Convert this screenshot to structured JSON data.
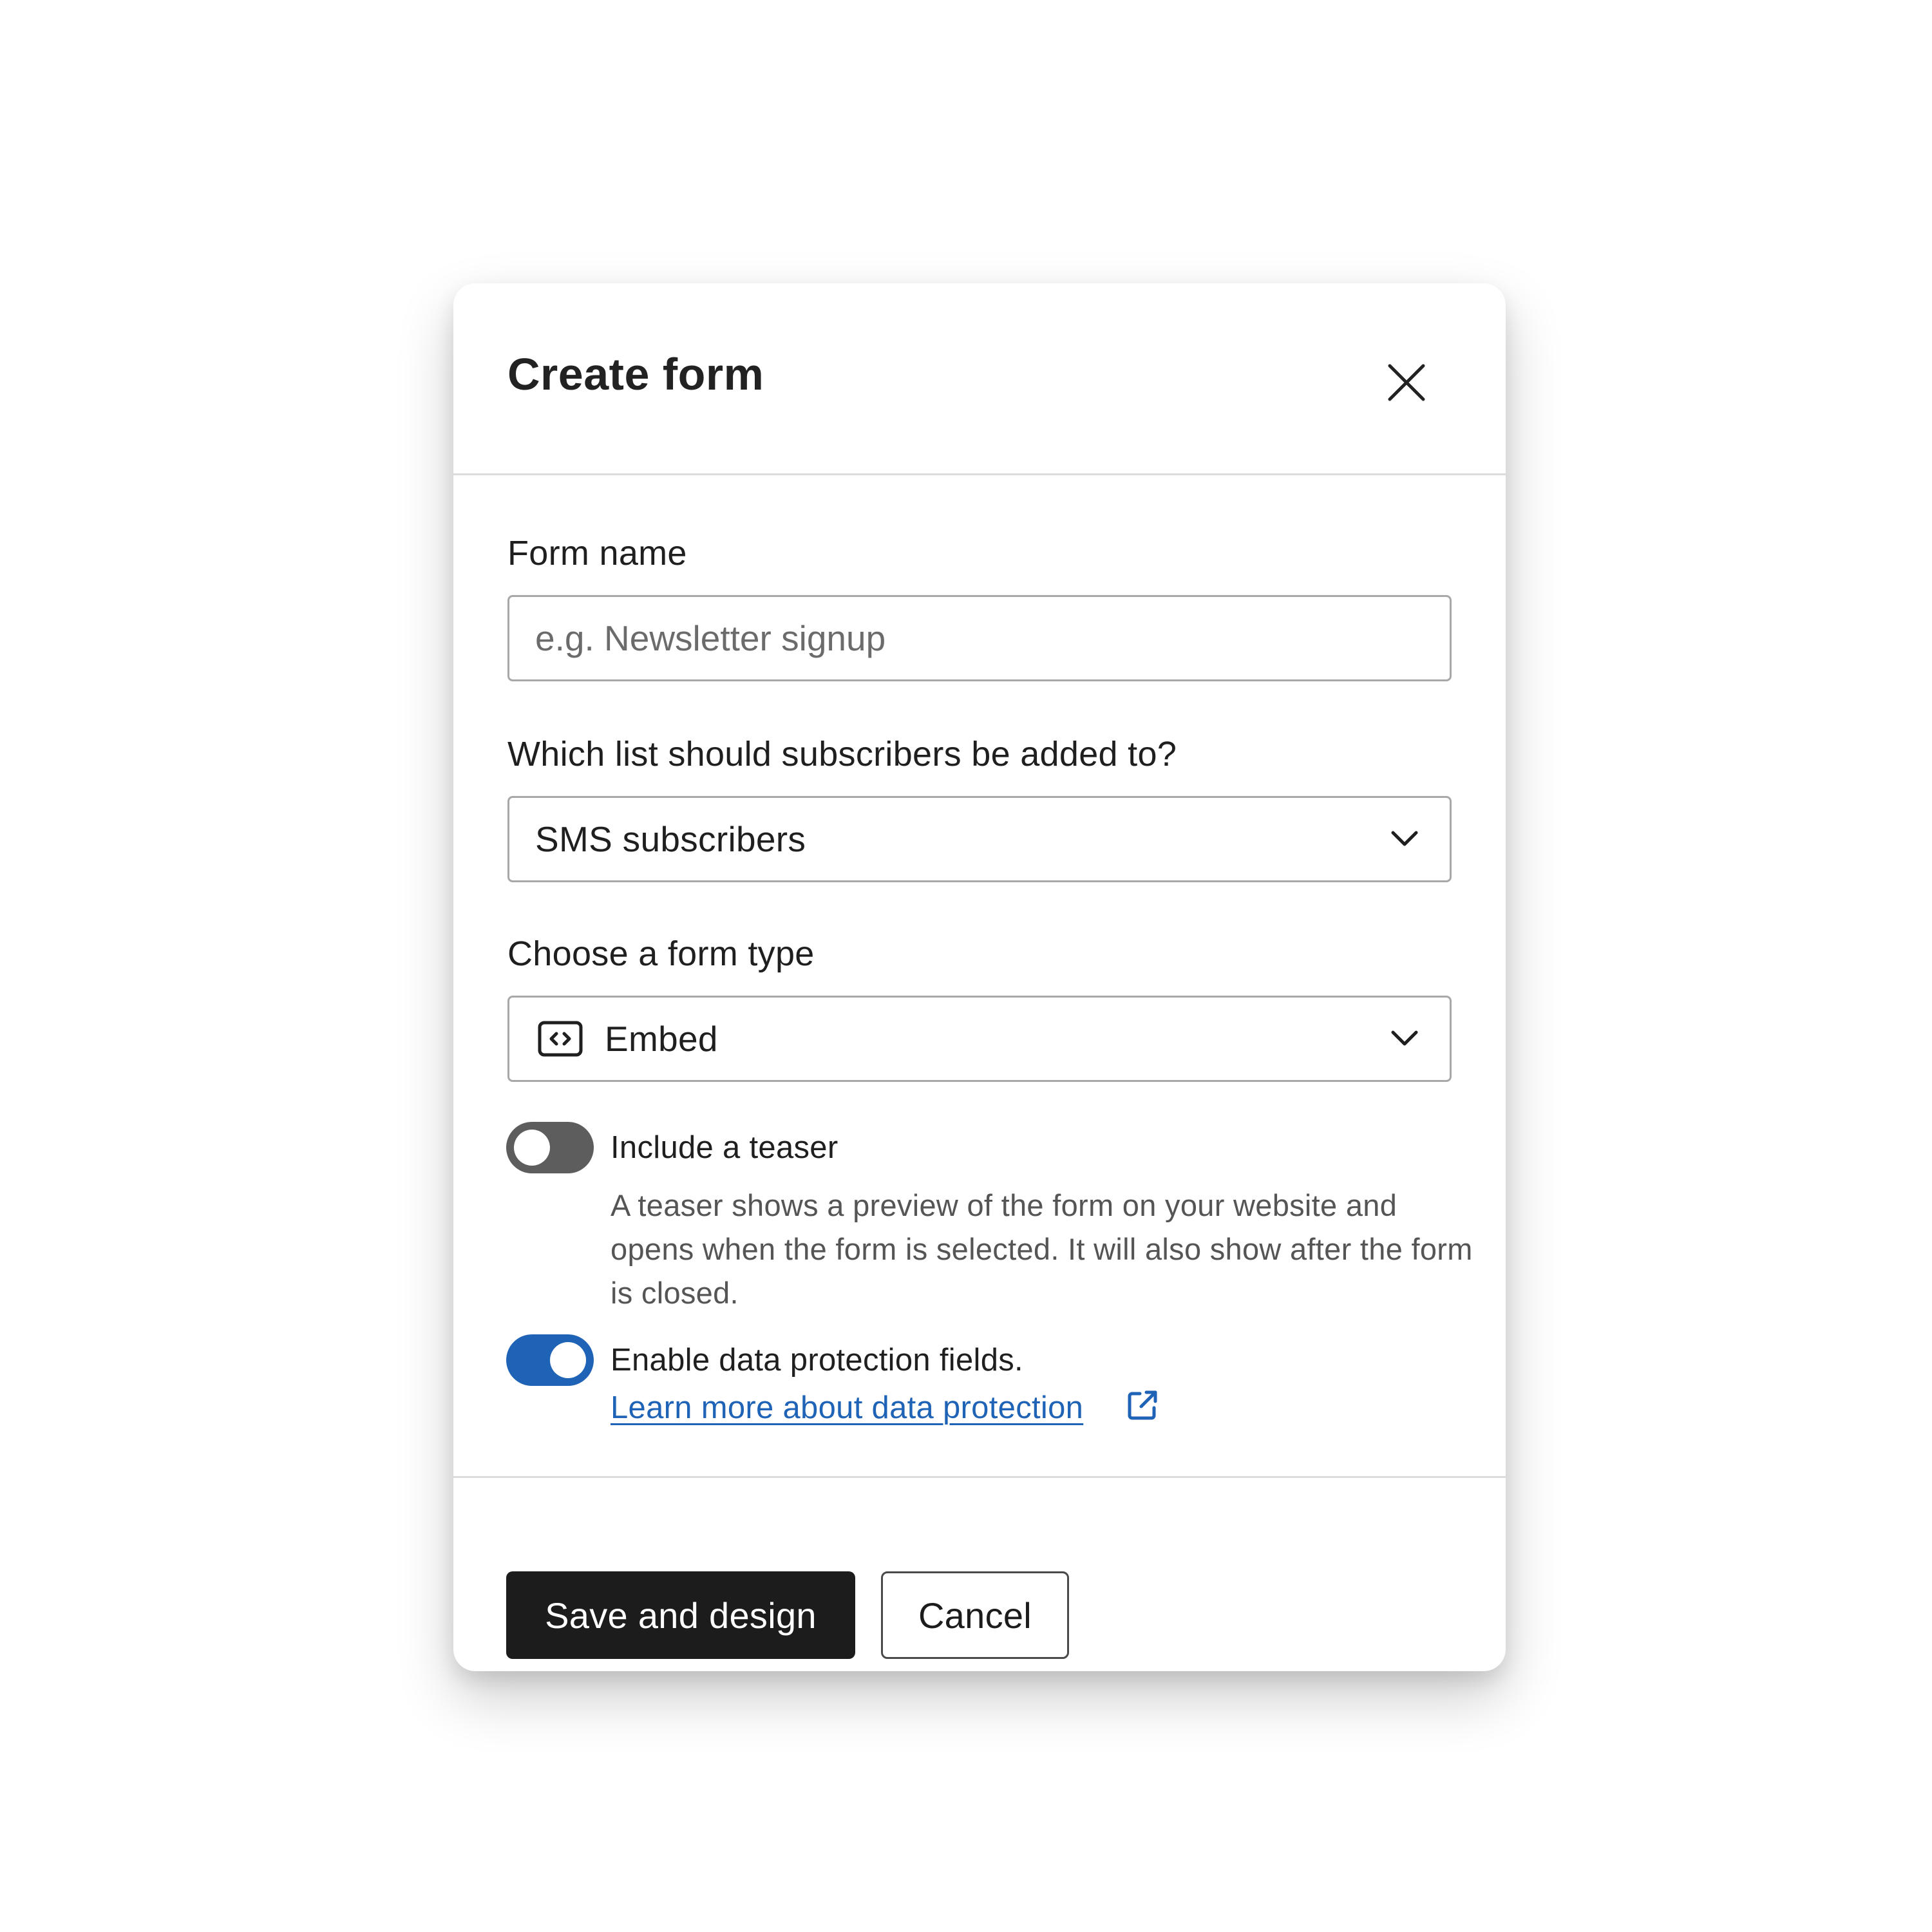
{
  "dialog": {
    "title": "Create form",
    "close_icon": "close-icon"
  },
  "form_name": {
    "label": "Form name",
    "placeholder": "e.g. Newsletter signup",
    "value": ""
  },
  "list_select": {
    "label": "Which list should subscribers be added to?",
    "selected": "SMS subscribers",
    "icon": "chevron-down-icon"
  },
  "form_type_select": {
    "label": "Choose a form type",
    "selected": "Embed",
    "option_icon": "embed-code-icon",
    "icon": "chevron-down-icon"
  },
  "teaser_toggle": {
    "label": "Include a teaser",
    "checked": false,
    "help_text": "A teaser shows a preview of the form on your website and opens when the form is selected. It will also show after the form is closed."
  },
  "data_protection_toggle": {
    "label": "Enable data protection fields.",
    "checked": true,
    "link_text": "Learn more about data protection",
    "link_icon": "external-link-icon"
  },
  "footer": {
    "primary_label": "Save and design",
    "secondary_label": "Cancel"
  },
  "colors": {
    "accent": "#1f63b7",
    "primary_button": "#1c1c1c",
    "toggle_off": "#5d5d5d",
    "divider": "#dcdcdc"
  }
}
